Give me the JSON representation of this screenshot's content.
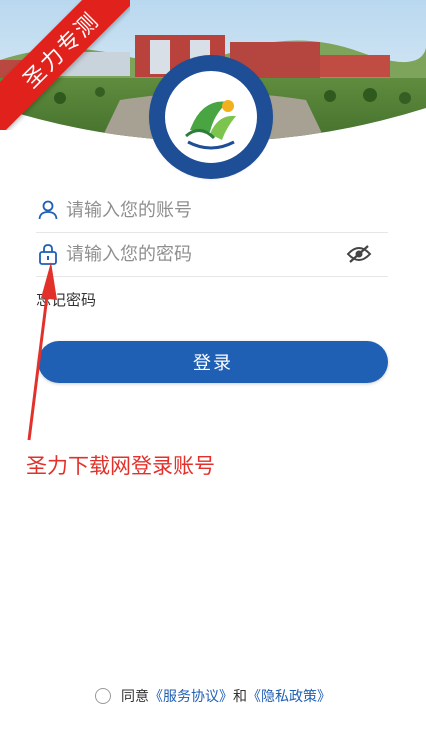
{
  "ribbon": {
    "text": "圣力专测"
  },
  "login": {
    "account_placeholder": "请输入您的账号",
    "password_placeholder": "请输入您的密码",
    "forgot_password": "忘记密码",
    "submit_label": "登录"
  },
  "annotation": {
    "text": "圣力下载网登录账号"
  },
  "agreement": {
    "prefix": "同意",
    "service_link": "《服务协议》",
    "conjunction": "和",
    "privacy_link": "《隐私政策》"
  },
  "colors": {
    "primary": "#1f5fb4",
    "annotation": "#e2312b",
    "ribbon": "#e1221c"
  },
  "icons": {
    "account": "user-icon",
    "password": "lock-icon",
    "toggle_visibility": "eye-off-icon"
  }
}
